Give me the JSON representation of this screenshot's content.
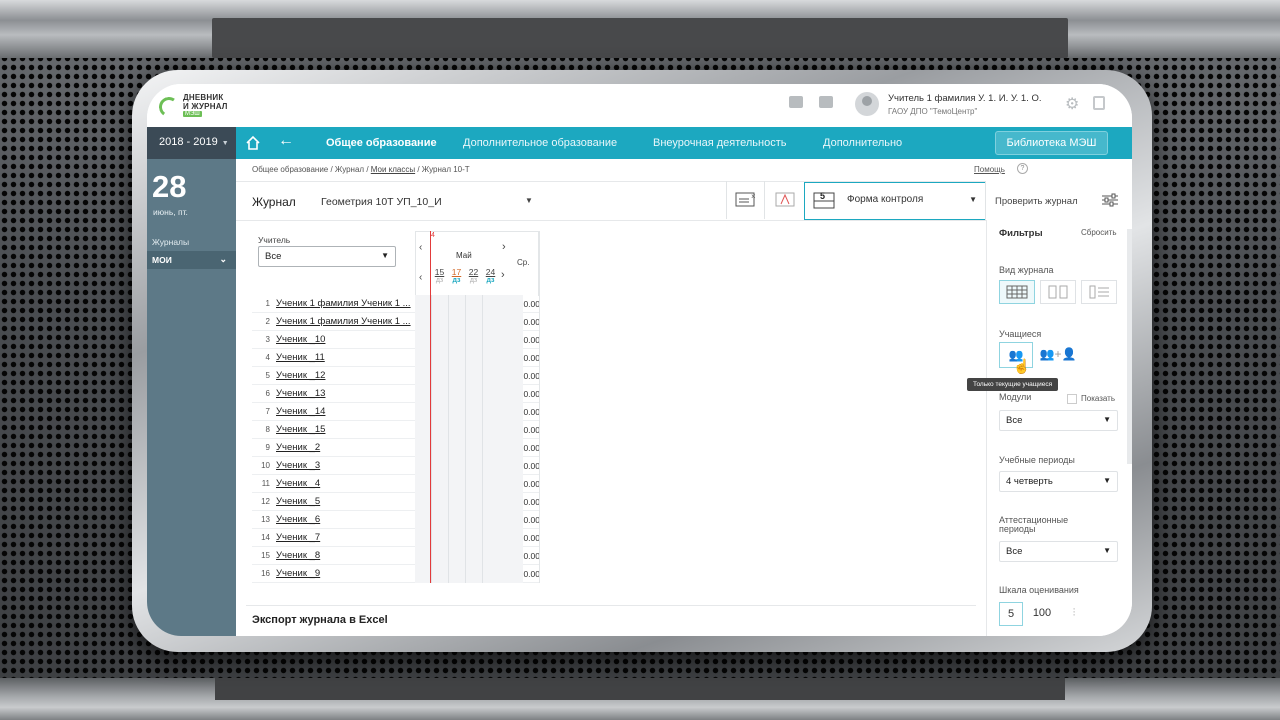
{
  "header": {
    "logo_line1": "ДНЕВНИК",
    "logo_line2": "И ЖУРНАЛ",
    "logo_badge": "МЭШ",
    "user_name": "Учитель 1 фамилия У. 1. И. У. 1. О.",
    "user_org": "ГАОУ ДПО \"ТемоЦентр\""
  },
  "nav": {
    "year": "2018 - 2019",
    "tabs": [
      "Общее образование",
      "Дополнительное образование",
      "Внеурочная деятельность",
      "Дополнительно"
    ],
    "library": "Библиотека МЭШ"
  },
  "sidebar": {
    "day": "28",
    "day_sub": "июнь, пт.",
    "journals": "Журналы",
    "moi": "МОИ"
  },
  "breadcrumb": {
    "a": "Общее образование / Журнал / ",
    "b": "Мои классы",
    "c": " / Журнал 10-Т"
  },
  "help": "Помощь",
  "toolbar": {
    "title": "Журнал",
    "subject": "Геометрия 10Т УП_10_И",
    "form_control": "Форма контроля",
    "form_icon_digit": "5",
    "check": "Проверить журнал"
  },
  "grid": {
    "teacher_label": "Учитель",
    "teacher_value": "Все",
    "month": "Май",
    "avg_header": "Ср.",
    "marker": "4",
    "dates": [
      {
        "n": "15",
        "k": "дз"
      },
      {
        "n": "17",
        "k": "дз"
      },
      {
        "n": "22",
        "k": "дз"
      },
      {
        "n": "24",
        "k": "дз"
      }
    ],
    "rows": [
      {
        "num": "1",
        "name": "Ученик 1 фамилия Ученик 1 ...",
        "avg": "0.00"
      },
      {
        "num": "2",
        "name": "Ученик 1 фамилия Ученик 1 ...",
        "avg": "0.00"
      },
      {
        "num": "3",
        "name": "Ученик _10",
        "avg": "0.00"
      },
      {
        "num": "4",
        "name": "Ученик _11",
        "avg": "0.00"
      },
      {
        "num": "5",
        "name": "Ученик _12",
        "avg": "0.00"
      },
      {
        "num": "6",
        "name": "Ученик _13",
        "avg": "0.00"
      },
      {
        "num": "7",
        "name": "Ученик _14",
        "avg": "0.00"
      },
      {
        "num": "8",
        "name": "Ученик _15",
        "avg": "0.00"
      },
      {
        "num": "9",
        "name": "Ученик _2",
        "avg": "0.00"
      },
      {
        "num": "10",
        "name": "Ученик _3",
        "avg": "0.00"
      },
      {
        "num": "11",
        "name": "Ученик _4",
        "avg": "0.00"
      },
      {
        "num": "12",
        "name": "Ученик _5",
        "avg": "0.00"
      },
      {
        "num": "13",
        "name": "Ученик _6",
        "avg": "0.00"
      },
      {
        "num": "14",
        "name": "Ученик _7",
        "avg": "0.00"
      },
      {
        "num": "15",
        "name": "Ученик _8",
        "avg": "0.00"
      },
      {
        "num": "16",
        "name": "Ученик _9",
        "avg": "0.00"
      }
    ],
    "export": "Экспорт журнала в Excel"
  },
  "filters": {
    "title": "Фильтры",
    "reset": "Сбросить",
    "view_label": "Вид журнала",
    "students_label": "Учащиеся",
    "tooltip": "Только текущие учащиеся",
    "modules_label": "Модули",
    "show": "Показать",
    "modules_value": "Все",
    "periods_label": "Учебные периоды",
    "periods_value": "4 четверть",
    "att_label_1": "Аттестационные",
    "att_label_2": "периоды",
    "att_value": "Все",
    "scale_label": "Шкала оценивания",
    "scale_options": [
      "5",
      "100"
    ]
  }
}
